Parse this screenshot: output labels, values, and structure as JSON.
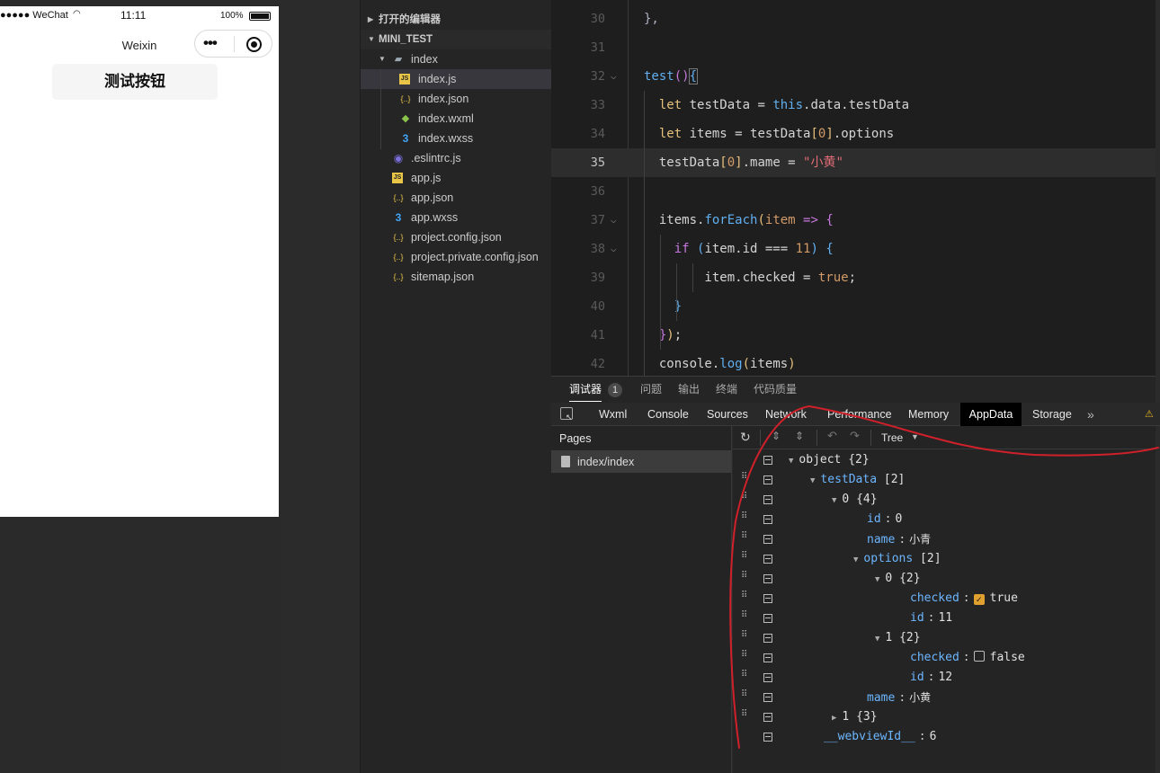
{
  "simulator": {
    "status_left": "●●●●● WeChat",
    "time": "11:11",
    "battery": "100%",
    "nav_title": "Weixin",
    "capsule_dots": "•••",
    "test_button": "测试按钮"
  },
  "explorer": {
    "open_editors": "打开的编辑器",
    "project": "MINI_TEST",
    "folder": "index",
    "files": [
      {
        "name": "index.js",
        "icon": "js"
      },
      {
        "name": "index.json",
        "icon": "json"
      },
      {
        "name": "index.wxml",
        "icon": "wxml"
      },
      {
        "name": "index.wxss",
        "icon": "wxss"
      },
      {
        "name": ".eslintrc.js",
        "icon": "eslint"
      },
      {
        "name": "app.js",
        "icon": "js"
      },
      {
        "name": "app.json",
        "icon": "json"
      },
      {
        "name": "app.wxss",
        "icon": "wxss"
      },
      {
        "name": "project.config.json",
        "icon": "json"
      },
      {
        "name": "project.private.config.json",
        "icon": "json"
      },
      {
        "name": "sitemap.json",
        "icon": "json"
      }
    ]
  },
  "editor": {
    "line_numbers": [
      "30",
      "31",
      "32",
      "33",
      "34",
      "35",
      "36",
      "37",
      "38",
      "39",
      "40",
      "41",
      "42"
    ],
    "current_line": "35"
  },
  "panel": {
    "tabs": [
      "调试器",
      "问题",
      "输出",
      "终端",
      "代码质量"
    ],
    "badge": "1"
  },
  "devtools": {
    "tabs": [
      "Wxml",
      "Console",
      "Sources",
      "Network",
      "Performance",
      "Memory",
      "AppData",
      "Storage"
    ],
    "active_tab": "AppData",
    "more": "»",
    "pages_header": "Pages",
    "page_item": "index/index",
    "view_mode": "Tree"
  },
  "tree": {
    "object": "object",
    "object_count": "{2}",
    "testData": "testData",
    "testData_count": "[2]",
    "item0": "0",
    "item0_count": "{4}",
    "id_key": "id",
    "id0": "0",
    "name_key": "name",
    "name0": "小青",
    "options_key": "options",
    "options_count": "[2]",
    "opt0": "0",
    "opt0_count": "{2}",
    "checked_key": "checked",
    "checked0": "true",
    "id11": "11",
    "opt1": "1",
    "opt1_count": "{2}",
    "checked1": "false",
    "id12": "12",
    "mame_key": "mame",
    "mame": "小黄",
    "item1": "1",
    "item1_count": "{3}",
    "webview_key": "__webviewId__",
    "webview": "6"
  },
  "colors": {
    "annotation": "#d0202a",
    "accent": "#e0a030"
  }
}
